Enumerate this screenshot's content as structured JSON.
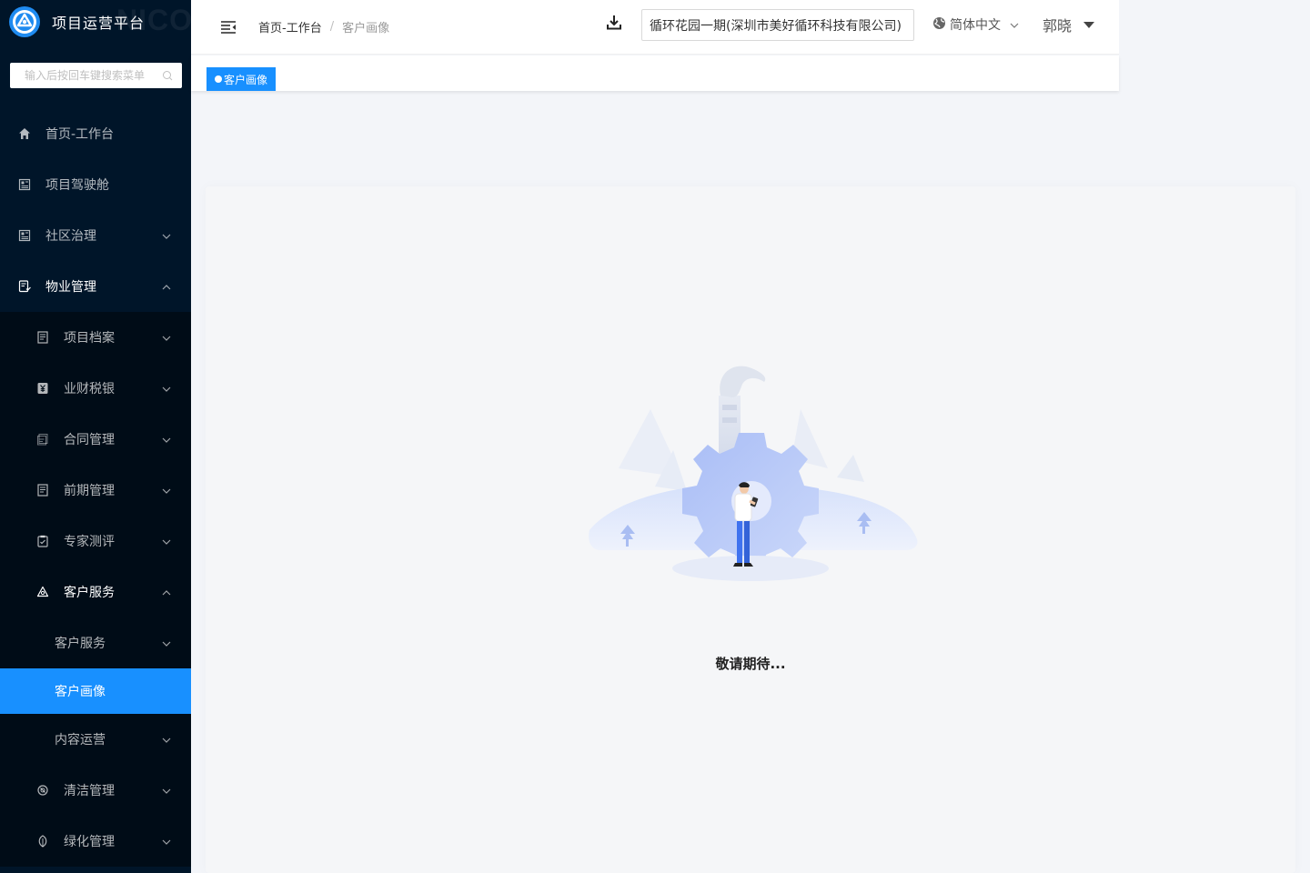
{
  "brand": {
    "title": "项目运营平台",
    "ghost": "NICORE"
  },
  "search": {
    "placeholder": "输入后按回车键搜索菜单"
  },
  "menu": {
    "home": "首页-工作台",
    "cockpit": "项目驾驶舱",
    "community": "社区治理",
    "property": "物业管理",
    "archive": "项目档案",
    "finance": "业财税银",
    "contract": "合同管理",
    "early": "前期管理",
    "expert": "专家测评",
    "customer": "客户服务",
    "customer_sub": "客户服务",
    "portrait": "客户画像",
    "content_ops": "内容运营",
    "cleaning": "清洁管理",
    "greening": "绿化管理"
  },
  "breadcrumb": {
    "home": "首页-工作台",
    "separator": "/",
    "current": "客户画像"
  },
  "header": {
    "project": "循环花园一期(深圳市美好循环科技有限公司)",
    "language": "简体中文",
    "user": "郭晓"
  },
  "tabs": [
    {
      "label": "客户画像"
    }
  ],
  "content": {
    "empty_text": "敬请期待..."
  },
  "colors": {
    "sidebar": "#001529",
    "accent": "#1890ff",
    "submenu": "#000c17"
  }
}
